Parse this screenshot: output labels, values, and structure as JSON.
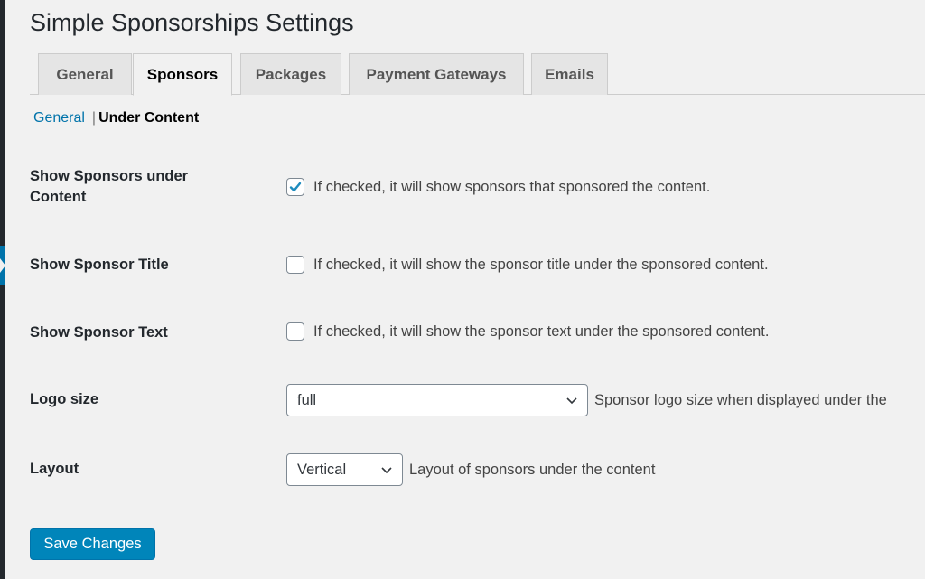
{
  "page": {
    "title": "Simple Sponsorships Settings"
  },
  "tabs": [
    {
      "label": "General",
      "active": false
    },
    {
      "label": "Sponsors",
      "active": true
    },
    {
      "label": "Packages",
      "active": false
    },
    {
      "label": "Payment Gateways",
      "active": false
    },
    {
      "label": "Emails",
      "active": false
    }
  ],
  "subnav": {
    "link": "General",
    "separator": "|",
    "current": "Under Content"
  },
  "settings": {
    "show_sponsors": {
      "label": "Show Sponsors under Content",
      "checked": true,
      "description": "If checked, it will show sponsors that sponsored the content."
    },
    "show_title": {
      "label": "Show Sponsor Title",
      "checked": false,
      "description": "If checked, it will show the sponsor title under the sponsored content."
    },
    "show_text": {
      "label": "Show Sponsor Text",
      "checked": false,
      "description": "If checked, it will show the sponsor text under the sponsored content."
    },
    "logo_size": {
      "label": "Logo size",
      "value": "full",
      "description": "Sponsor logo size when displayed under the"
    },
    "layout": {
      "label": "Layout",
      "value": "Vertical",
      "description": "Layout of sponsors under the content"
    }
  },
  "actions": {
    "save_label": "Save Changes"
  },
  "colors": {
    "accent": "#0073aa",
    "button": "#0085ba",
    "background": "#f1f1f1",
    "sidebar": "#23282d"
  }
}
